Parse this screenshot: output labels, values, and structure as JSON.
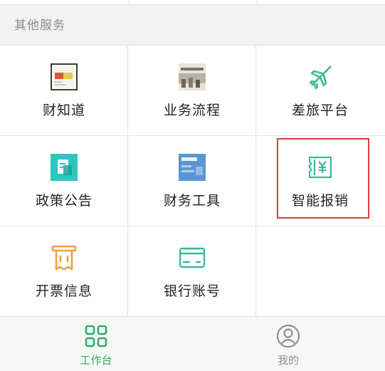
{
  "section": {
    "title": "其他服务"
  },
  "services": [
    {
      "label": "财知道",
      "icon": "finance-knowledge-icon"
    },
    {
      "label": "业务流程",
      "icon": "business-process-icon"
    },
    {
      "label": "差旅平台",
      "icon": "airplane-icon"
    },
    {
      "label": "政策公告",
      "icon": "policy-notice-icon"
    },
    {
      "label": "财务工具",
      "icon": "finance-tools-icon"
    },
    {
      "label": "智能报销",
      "icon": "yuan-receipt-icon"
    },
    {
      "label": "开票信息",
      "icon": "invoice-receipt-icon"
    },
    {
      "label": "银行账号",
      "icon": "bank-card-icon"
    }
  ],
  "tabbar": {
    "tabs": [
      {
        "label": "工作台",
        "icon": "workbench-grid-icon",
        "active": true
      },
      {
        "label": "我的",
        "icon": "profile-icon",
        "active": false
      }
    ]
  },
  "colors": {
    "accent_green": "#2eae6a",
    "teal": "#3cb89c",
    "orange": "#f0a040",
    "highlight_red": "#e03c3c",
    "inactive_gray": "#8f8f8f"
  }
}
